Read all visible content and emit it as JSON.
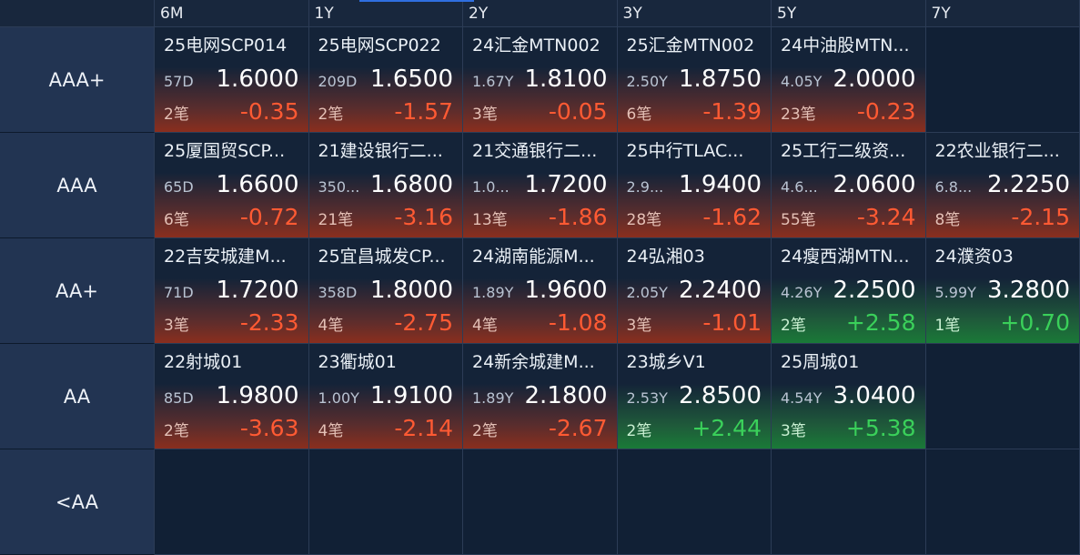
{
  "tenors": [
    "6M",
    "1Y",
    "2Y",
    "3Y",
    "5Y",
    "7Y"
  ],
  "rows": [
    {
      "rating": "AAA+",
      "cells": [
        {
          "name": "25电网SCP014",
          "term": "57D",
          "yield": "1.6000",
          "count": "2笔",
          "chg": "-0.35",
          "dir": "neg"
        },
        {
          "name": "25电网SCP022",
          "term": "209D",
          "yield": "1.6500",
          "count": "2笔",
          "chg": "-1.57",
          "dir": "neg"
        },
        {
          "name": "24汇金MTN002",
          "term": "1.67Y",
          "yield": "1.8100",
          "count": "3笔",
          "chg": "-0.05",
          "dir": "neg"
        },
        {
          "name": "25汇金MTN002",
          "term": "2.50Y",
          "yield": "1.8750",
          "count": "6笔",
          "chg": "-1.39",
          "dir": "neg"
        },
        {
          "name": "24中油股MTN...",
          "term": "4.05Y",
          "yield": "2.0000",
          "count": "23笔",
          "chg": "-0.23",
          "dir": "neg"
        },
        null
      ]
    },
    {
      "rating": "AAA",
      "cells": [
        {
          "name": "25厦国贸SCP...",
          "term": "65D",
          "yield": "1.6600",
          "count": "6笔",
          "chg": "-0.72",
          "dir": "neg"
        },
        {
          "name": "21建设银行二...",
          "term": "350...",
          "yield": "1.6800",
          "count": "21笔",
          "chg": "-3.16",
          "dir": "neg"
        },
        {
          "name": "21交通银行二...",
          "term": "1.0...",
          "yield": "1.7200",
          "count": "13笔",
          "chg": "-1.86",
          "dir": "neg"
        },
        {
          "name": "25中行TLAC...",
          "term": "2.9...",
          "yield": "1.9400",
          "count": "28笔",
          "chg": "-1.62",
          "dir": "neg"
        },
        {
          "name": "25工行二级资...",
          "term": "4.6...",
          "yield": "2.0600",
          "count": "55笔",
          "chg": "-3.24",
          "dir": "neg"
        },
        {
          "name": "22农业银行二...",
          "term": "6.8...",
          "yield": "2.2250",
          "count": "8笔",
          "chg": "-2.15",
          "dir": "neg"
        }
      ]
    },
    {
      "rating": "AA+",
      "cells": [
        {
          "name": "22吉安城建M...",
          "term": "71D",
          "yield": "1.7200",
          "count": "3笔",
          "chg": "-2.33",
          "dir": "neg"
        },
        {
          "name": "25宜昌城发CP...",
          "term": "358D",
          "yield": "1.8000",
          "count": "4笔",
          "chg": "-2.75",
          "dir": "neg"
        },
        {
          "name": "24湖南能源M...",
          "term": "1.89Y",
          "yield": "1.9600",
          "count": "4笔",
          "chg": "-1.08",
          "dir": "neg"
        },
        {
          "name": "24弘湘03",
          "term": "2.05Y",
          "yield": "2.2400",
          "count": "3笔",
          "chg": "-1.01",
          "dir": "neg"
        },
        {
          "name": "24瘦西湖MTN...",
          "term": "4.26Y",
          "yield": "2.2500",
          "count": "2笔",
          "chg": "+2.58",
          "dir": "pos"
        },
        {
          "name": "24濮资03",
          "term": "5.99Y",
          "yield": "3.2800",
          "count": "1笔",
          "chg": "+0.70",
          "dir": "pos"
        }
      ]
    },
    {
      "rating": "AA",
      "cells": [
        {
          "name": "22射城01",
          "term": "85D",
          "yield": "1.9800",
          "count": "2笔",
          "chg": "-3.63",
          "dir": "neg"
        },
        {
          "name": "23衢城01",
          "term": "1.00Y",
          "yield": "1.9100",
          "count": "4笔",
          "chg": "-2.14",
          "dir": "neg"
        },
        {
          "name": "24新余城建M...",
          "term": "1.89Y",
          "yield": "2.1800",
          "count": "2笔",
          "chg": "-2.67",
          "dir": "neg"
        },
        {
          "name": "23城乡V1",
          "term": "2.53Y",
          "yield": "2.8500",
          "count": "2笔",
          "chg": "+2.44",
          "dir": "pos"
        },
        {
          "name": "25周城01",
          "term": "4.54Y",
          "yield": "3.0400",
          "count": "3笔",
          "chg": "+5.38",
          "dir": "pos"
        },
        null
      ]
    },
    {
      "rating": "<AA",
      "cells": [
        null,
        null,
        null,
        null,
        null,
        null
      ]
    }
  ],
  "colors": {
    "down": "#ff5a33",
    "up": "#3ad05a",
    "accent": "#2f6fe0"
  }
}
